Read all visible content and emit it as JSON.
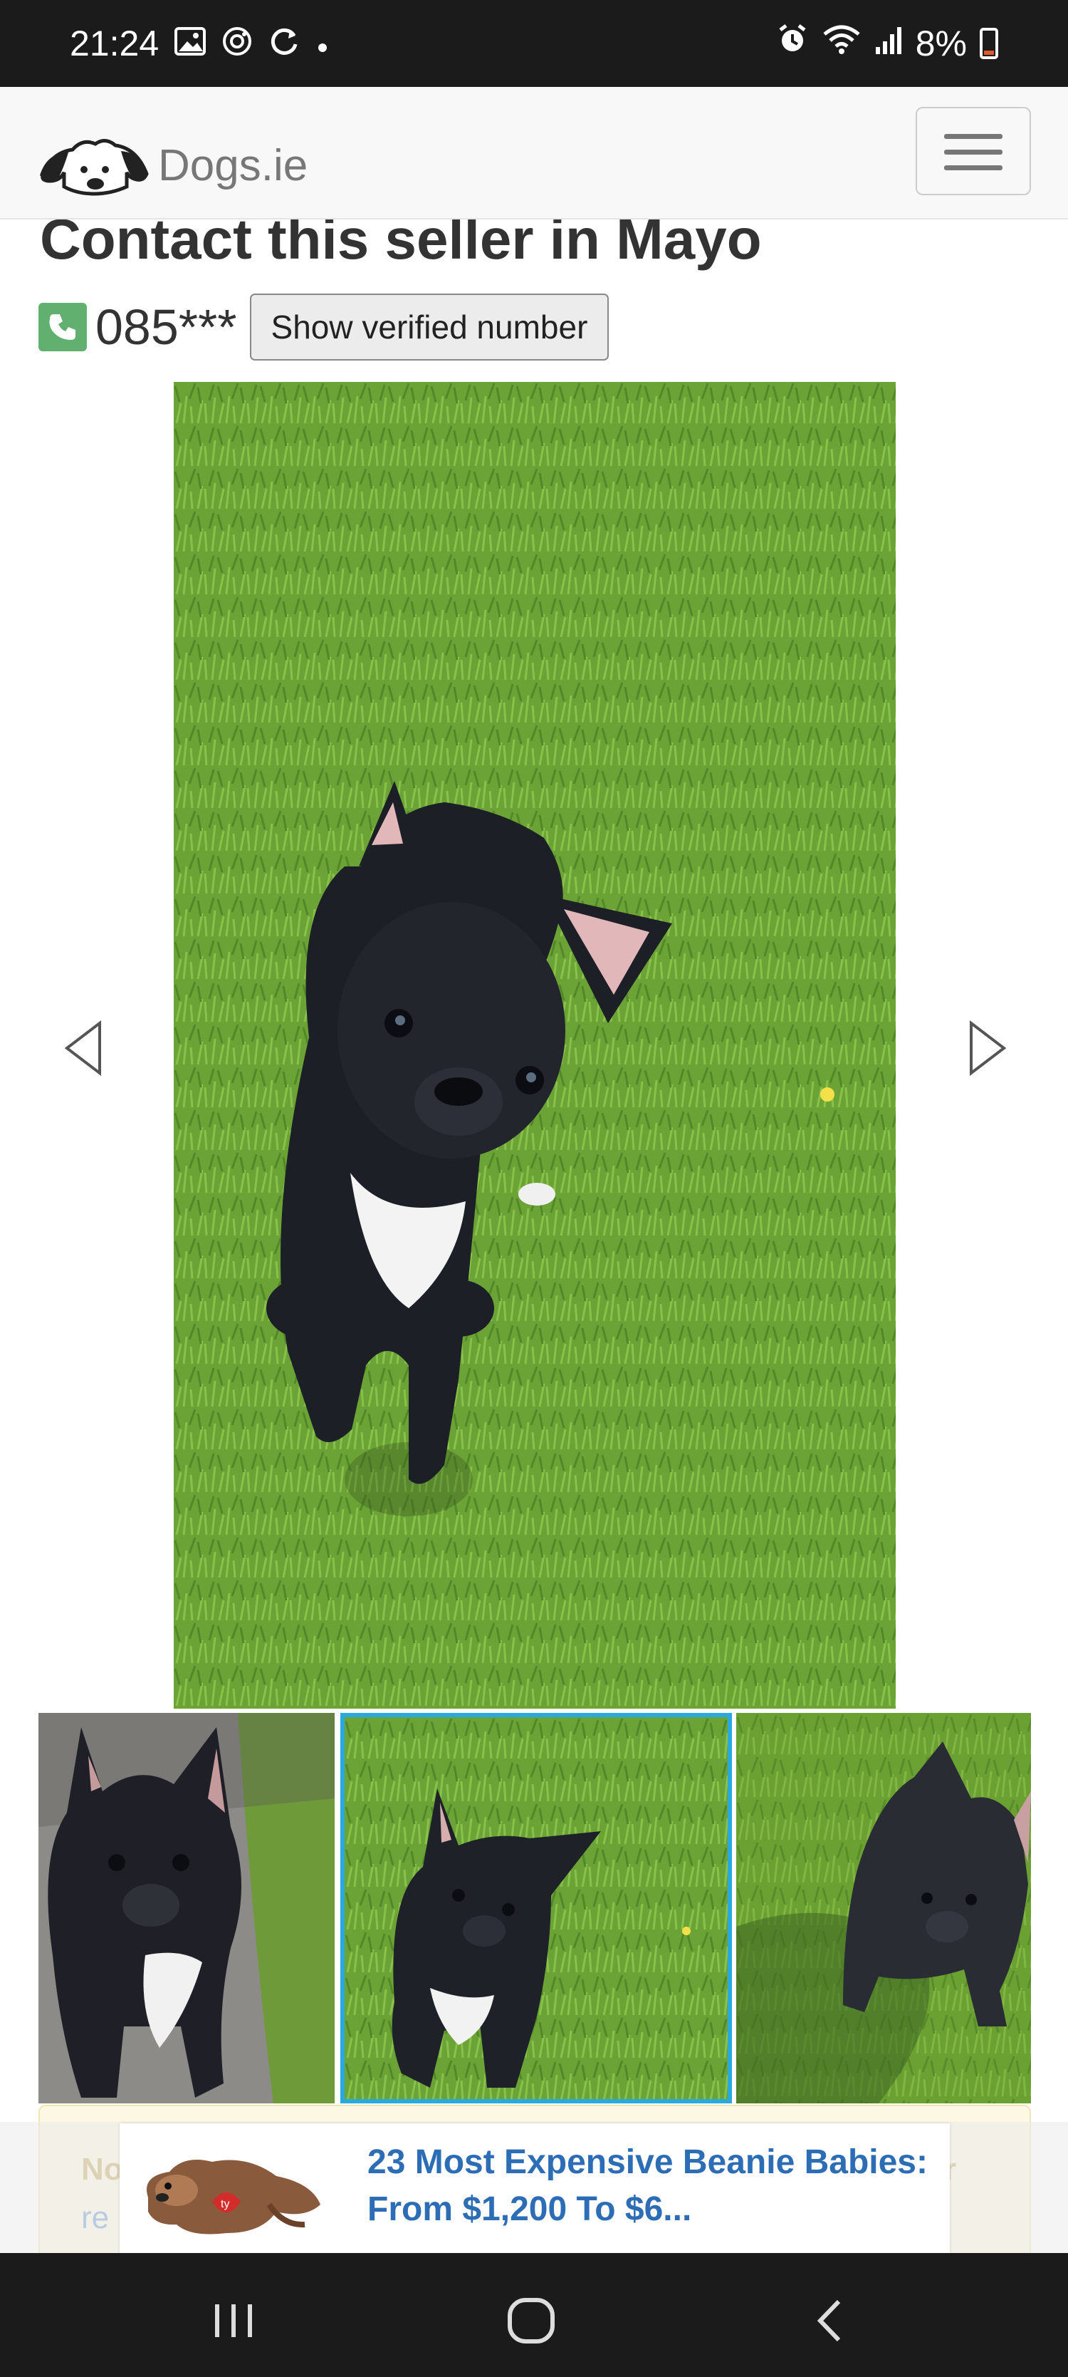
{
  "status_bar": {
    "time": "21:24",
    "left_icons": [
      "gallery-icon",
      "instagram-icon",
      "sync-icon",
      "dot-icon"
    ],
    "right_icons": [
      "alarm-icon",
      "wifi-icon",
      "signal-icon"
    ],
    "battery": "8%"
  },
  "navbar": {
    "brand": "Dogs.ie"
  },
  "listing": {
    "contact_title": "Contact this seller in Mayo",
    "phone_partial": "085***",
    "show_number_label": "Show verified number"
  },
  "gallery": {
    "selected_index": 1,
    "thumbnail_count": 3
  },
  "notice": {
    "text_start": "No",
    "text_end": "r",
    "link_start": "re"
  },
  "ad": {
    "headline_line1": "23 Most Expensive Beanie Babies:",
    "headline_line2": "From $1,200 To $6..."
  },
  "colors": {
    "accent_selected": "#29a9e0",
    "ad_link": "#2c6db6",
    "phone_badge": "#62b070"
  }
}
